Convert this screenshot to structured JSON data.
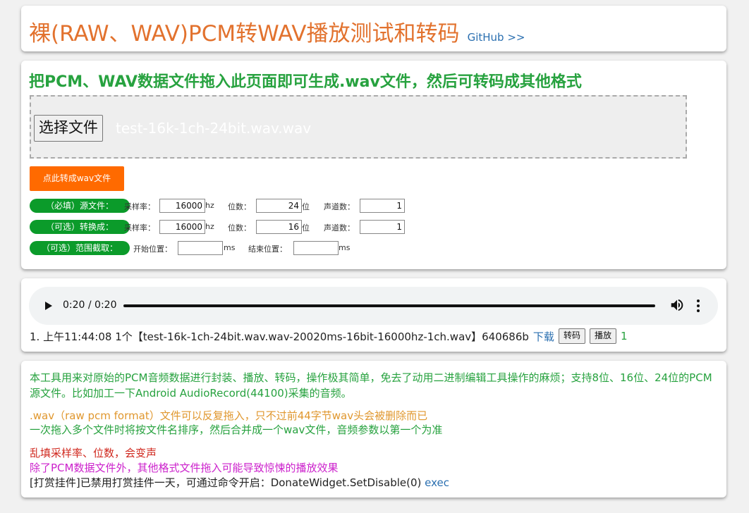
{
  "header": {
    "title": "裸(RAW、WAV)PCM转WAV播放测试和转码",
    "github_link": "GitHub >>"
  },
  "main": {
    "heading": "把PCM、WAV数据文件拖入此页面即可生成.wav文件，然后可转码成其他格式",
    "choose_file_label": "选择文件",
    "file_name": "test-16k-1ch-24bit.wav.wav",
    "convert_button": "点此转成wav文件",
    "source": {
      "label": "（必填）源文件：",
      "sample_rate_label": "采样率：",
      "sample_rate": "16000",
      "hz_unit": "hz",
      "bits_label": "位数：",
      "bits": "24",
      "bits_unit": "位",
      "channels_label": "声道数：",
      "channels": "1"
    },
    "target": {
      "label": "（可选）转换成：",
      "sample_rate_label": "采样率：",
      "sample_rate": "16000",
      "hz_unit": "hz",
      "bits_label": "位数：",
      "bits": "16",
      "bits_unit": "位",
      "channels_label": "声道数：",
      "channels": "1"
    },
    "range": {
      "label": "（可选）范围截取：",
      "start_label": "开始位置：",
      "start_value": "",
      "start_unit": "ms",
      "end_label": "结束位置：",
      "end_value": "",
      "end_unit": "ms"
    }
  },
  "player": {
    "time": "0:20 / 0:20",
    "record": {
      "prefix": "1. 上午11:44:08 1个",
      "file": "【test-16k-1ch-24bit.wav.wav-20020ms-16bit-16000hz-1ch.wav】640686b",
      "download": "下载",
      "transcode_button": "转码",
      "play_button": "播放",
      "count": "1"
    }
  },
  "info": {
    "line1": "本工具用来对原始的PCM音频数据进行封装、播放、转码，操作极其简单，免去了动用二进制编辑工具操作的麻烦；支持8位、16位、24位的PCM源文件。比如加工一下Android AudioRecord(44100)采集的音频。",
    "line2": ".wav（raw pcm format）文件可以反复拖入，只不过前44字节wav头会被删除而已",
    "line3": "一次拖入多个文件时将按文件名排序，然后合并成一个wav文件，音频参数以第一个为准",
    "line4": "乱填采样率、位数，会变声",
    "line5": "除了PCM数据文件外，其他格式文件拖入可能导致惊悚的播放效果",
    "line6": "[打赏挂件]已禁用打赏挂件一天，可通过命令开启：DonateWidget.SetDisable(0)",
    "exec_link": "exec"
  },
  "colors": {
    "title": "#e2722e",
    "link": "#2a6fb0",
    "green": "#27a23f",
    "orange_button": "#ff6a00",
    "pill": "#0b9b2a",
    "warning_orange": "#e0972e",
    "warning_red": "#d0281e",
    "magenta": "#cc22cc"
  }
}
